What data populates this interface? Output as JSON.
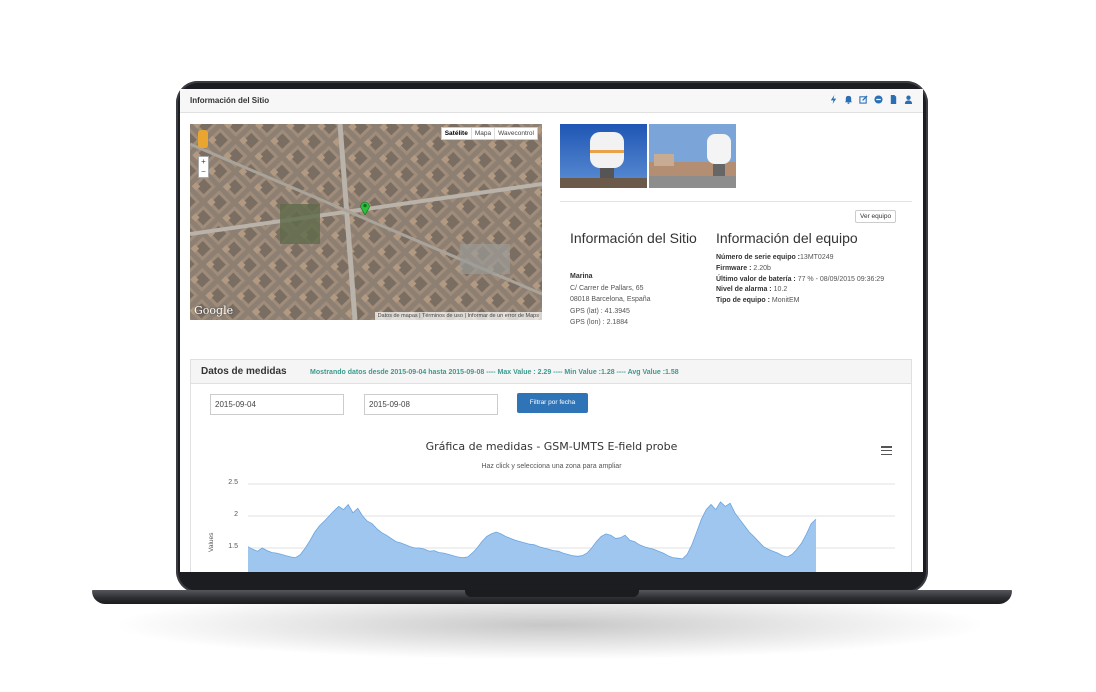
{
  "header": {
    "title": "Información del Sitio",
    "icons": [
      "bolt-icon",
      "bell-icon",
      "edit-icon",
      "minus-circle-icon",
      "file-icon",
      "user-icon"
    ]
  },
  "map": {
    "types": [
      "Satélite",
      "Mapa",
      "Wavecontrol"
    ],
    "active_type": "Satélite",
    "zoom_in": "+",
    "zoom_out": "−",
    "logo": "Google",
    "footer": "Datos de mapas | Términos de uso | Informar de un error de Maps"
  },
  "buttons": {
    "ver_equipo": "Ver equipo",
    "filtrar": "Filtrar por fecha"
  },
  "sitio": {
    "heading": "Información del Sitio",
    "name": "Marina",
    "address1": "C/ Carrer de Pallars, 65",
    "address2": "08018 Barcelona, España",
    "gps_lat": "GPS (lat) : 41.3945",
    "gps_lon": "GPS (lon) : 2.1884"
  },
  "equipo": {
    "heading": "Información del equipo",
    "serie_label": "Número de serie equipo :",
    "serie_value": "13MT0249",
    "firmware_label": "Firmware :",
    "firmware_value": " 2.20b",
    "bateria_label": "Último valor de batería :",
    "bateria_value": " 77 % - 08/09/2015 09:36:29",
    "alarma_label": "Nivel de alarma :",
    "alarma_value": " 10.2",
    "tipo_label": "Tipo de equipo :",
    "tipo_value": " MonitEM"
  },
  "medidas": {
    "title": "Datos de medidas",
    "summary": "Mostrando datos desde 2015-09-04 hasta 2015-09-08 ---- Max Value : 2.29 ---- Min Value :1.28 ---- Avg Value :1.58",
    "date_from": "2015-09-04",
    "date_to": "2015-09-08"
  },
  "chart_data": {
    "type": "area",
    "title": "Gráfica de medidas - GSM-UMTS E-field probe",
    "subtitle": "Haz click y selecciona una zona para ampliar",
    "ylabel": "Values",
    "yticks": [
      "2.5",
      "2",
      "1.5"
    ],
    "ylim": [
      1.28,
      2.5
    ],
    "grid": true,
    "color": "#9ec6ef",
    "line_color": "#6aa5e0",
    "values": [
      1.52,
      1.48,
      1.45,
      1.5,
      1.46,
      1.43,
      1.42,
      1.4,
      1.38,
      1.36,
      1.35,
      1.4,
      1.5,
      1.62,
      1.75,
      1.85,
      1.92,
      2.0,
      2.08,
      2.15,
      2.1,
      2.18,
      2.05,
      2.12,
      2.0,
      1.92,
      1.88,
      1.8,
      1.74,
      1.7,
      1.65,
      1.6,
      1.58,
      1.55,
      1.52,
      1.5,
      1.5,
      1.48,
      1.45,
      1.46,
      1.43,
      1.42,
      1.4,
      1.38,
      1.36,
      1.35,
      1.36,
      1.42,
      1.5,
      1.6,
      1.68,
      1.72,
      1.75,
      1.72,
      1.68,
      1.65,
      1.62,
      1.6,
      1.58,
      1.56,
      1.55,
      1.52,
      1.5,
      1.48,
      1.46,
      1.45,
      1.42,
      1.4,
      1.38,
      1.37,
      1.38,
      1.42,
      1.5,
      1.6,
      1.68,
      1.72,
      1.7,
      1.65,
      1.66,
      1.7,
      1.62,
      1.6,
      1.55,
      1.52,
      1.5,
      1.48,
      1.45,
      1.42,
      1.38,
      1.35,
      1.34,
      1.33,
      1.4,
      1.55,
      1.75,
      1.95,
      2.1,
      2.18,
      2.1,
      2.22,
      2.15,
      2.2,
      2.05,
      1.95,
      1.85,
      1.75,
      1.68,
      1.6,
      1.52,
      1.48,
      1.45,
      1.42,
      1.38,
      1.36,
      1.4,
      1.48,
      1.58,
      1.72,
      1.88,
      1.95
    ]
  }
}
